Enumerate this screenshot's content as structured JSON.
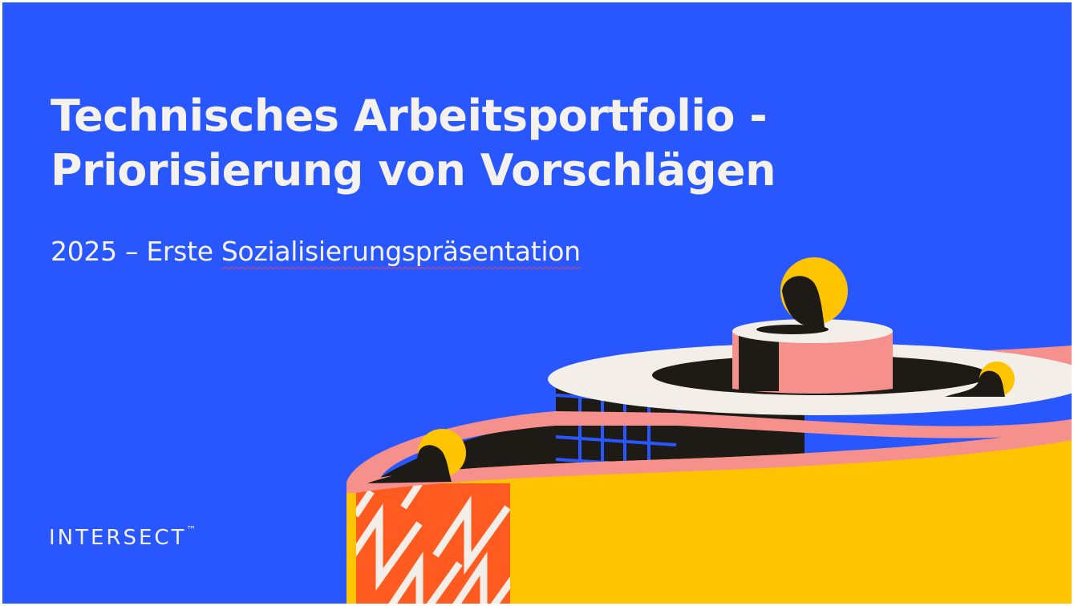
{
  "slide": {
    "title_line_1": "Technisches Arbeitsportfolio -",
    "title_line_2": "Priorisierung von Vorschlägen",
    "subtitle_prefix": "2025 – Erste ",
    "subtitle_flagged_word": "Sozialisierungspräsentation",
    "brand": "INTERSECT",
    "brand_mark": "™",
    "illustration": "abstract-spiral-tower"
  },
  "colors": {
    "background": "#2957FF",
    "text": "#F5F2EE",
    "yellow": "#FFC400",
    "pink": "#F6908D",
    "cream": "#F3EFE8",
    "black": "#1E1A16",
    "orange": "#FF5A1F",
    "spellcheck": "#E0425A"
  }
}
